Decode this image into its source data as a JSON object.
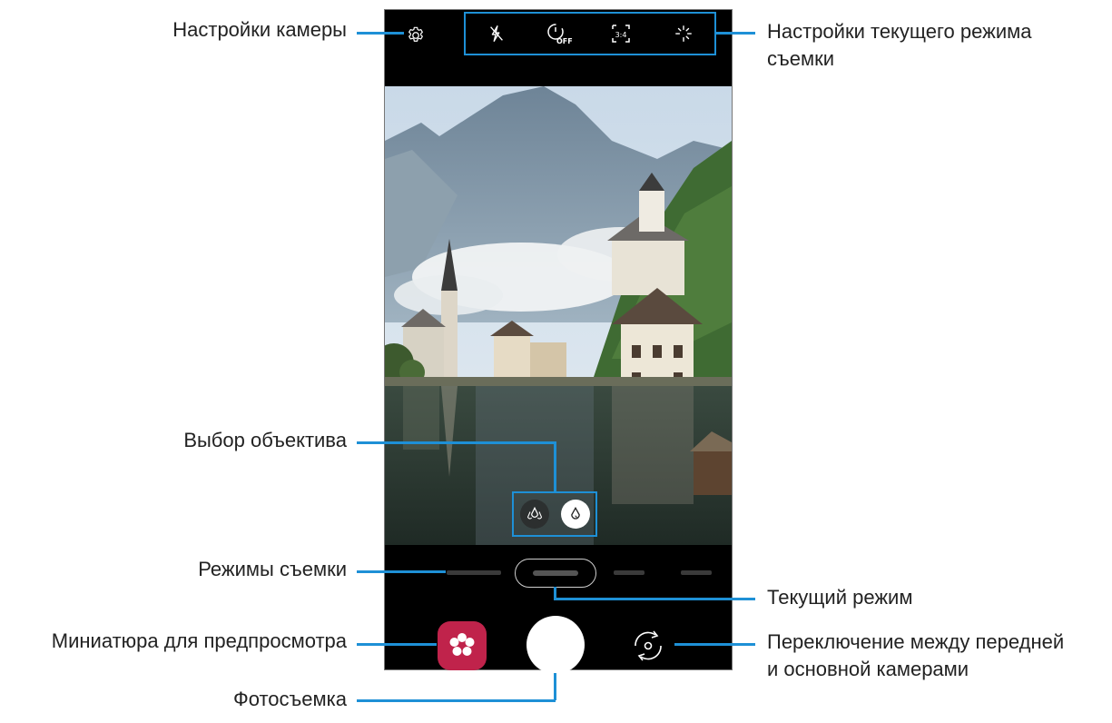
{
  "callouts": {
    "camera_settings": "Настройки камеры",
    "current_mode_settings_line1": "Настройки текущего режима",
    "current_mode_settings_line2": "съемки",
    "lens_selection": "Выбор объектива",
    "shooting_modes": "Режимы съемки",
    "current_mode": "Текущий режим",
    "preview_thumbnail": "Миниатюра для предпросмотра",
    "switch_camera_line1": "Переключение между передней",
    "switch_camera_line2": "и основной камерами",
    "take_photo": "Фотосъемка"
  },
  "toolbar": {
    "icons": [
      "flash-off-icon",
      "timer-off-icon",
      "aspect-ratio-icon",
      "filter-effects-icon"
    ],
    "timer_label": "OFF",
    "ratio_label": "3:4"
  },
  "lens": {
    "options": [
      "ultra-wide-lens-icon",
      "wide-lens-icon"
    ],
    "active": "wide-lens-icon"
  },
  "colors": {
    "accent": "#1e90d6",
    "thumbnail": "#c0234b",
    "phone_bg": "#000000"
  }
}
